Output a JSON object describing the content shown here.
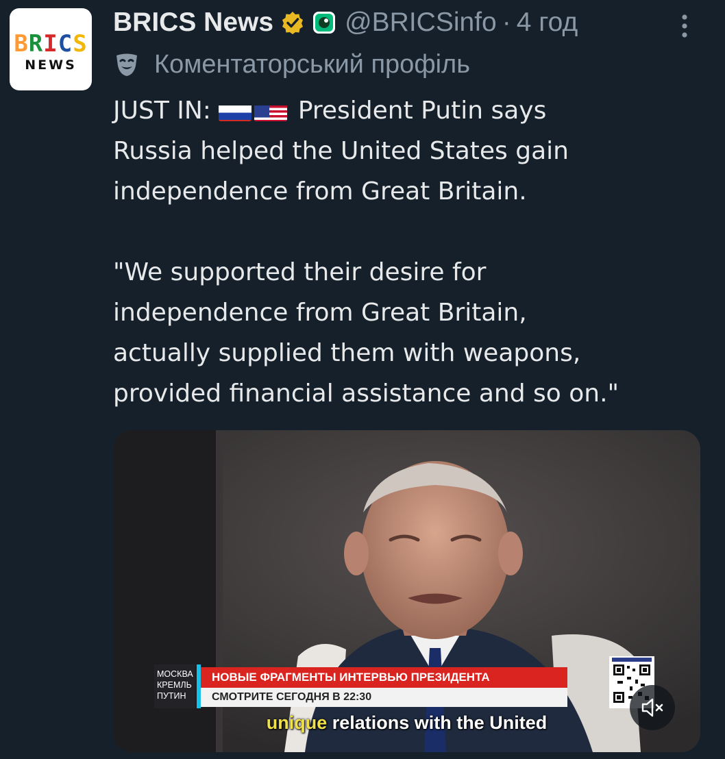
{
  "author": {
    "display_name": "BRICS News",
    "handle": "@BRICSinfo",
    "separator": "·",
    "time": "4 год",
    "avatar": {
      "logo_word": "BRICS",
      "logo_sub": "NEWS",
      "colors": [
        "#ff9933",
        "#1a8f3c",
        "#d62828",
        "#1f4fa0",
        "#f2b705"
      ]
    },
    "verified_icon": "gold-verified-badge-icon",
    "affiliate_icon": "green-badge-icon"
  },
  "profile_label": {
    "icon": "theater-mask-icon",
    "text": "Коментаторський профіль"
  },
  "menu_icon": "more-vertical-icon",
  "tweet": {
    "line1_prefix": "JUST IN: ",
    "flags": [
      "russia-flag-icon",
      "usa-flag-icon"
    ],
    "line1_rest": " President Putin says\nRussia helped the United States gain\nindependence from Great Britain.",
    "quote": "\"We supported their desire for\nindependence from Great Britain,\nactually supplied them with weapons,\nprovided financial assistance and so on.\""
  },
  "video": {
    "chyron": {
      "location_lines": [
        "МОСКВА",
        "КРЕМЛЬ",
        "ПУТИН"
      ],
      "headline": "НОВЫЕ ФРАГМЕНТЫ ИНТЕРВЬЮ ПРЕЗИДЕНТА",
      "schedule": "СМОТРИТЕ СЕГОДНЯ В 22:30"
    },
    "subtitle": {
      "highlight": "unique",
      "rest": " relations with the United"
    },
    "mute_icon": "speaker-muted-icon",
    "colors": {
      "accent_cyan": "#16c0e8",
      "chyron_red": "#d9241f",
      "subtitle_highlight": "#f0e14a"
    }
  },
  "theme": {
    "background": "#15202b",
    "text_primary": "#e7e9ea",
    "text_secondary": "#8b98a5",
    "verified_gold": "#e8b923",
    "affiliate_green": "#00ba7c"
  }
}
